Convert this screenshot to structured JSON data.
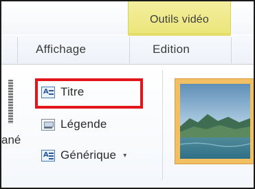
{
  "contextual_tab": {
    "label": "Outils vidéo",
    "color": "#EDE77F"
  },
  "tabs": [
    {
      "label": "Affichage"
    },
    {
      "label": "Edition"
    }
  ],
  "ribbon": {
    "cut_text": "ané",
    "items": [
      {
        "label": "Titre",
        "icon": "title-icon",
        "highlighted": true
      },
      {
        "label": "Légende",
        "icon": "caption-icon"
      },
      {
        "label": "Générique",
        "icon": "credits-icon",
        "has_dropdown": true,
        "dropdown_glyph": "▾"
      }
    ]
  },
  "highlight_color": "#E3151A",
  "thumbnail": {
    "icon": "video-thumbnail-icon"
  }
}
